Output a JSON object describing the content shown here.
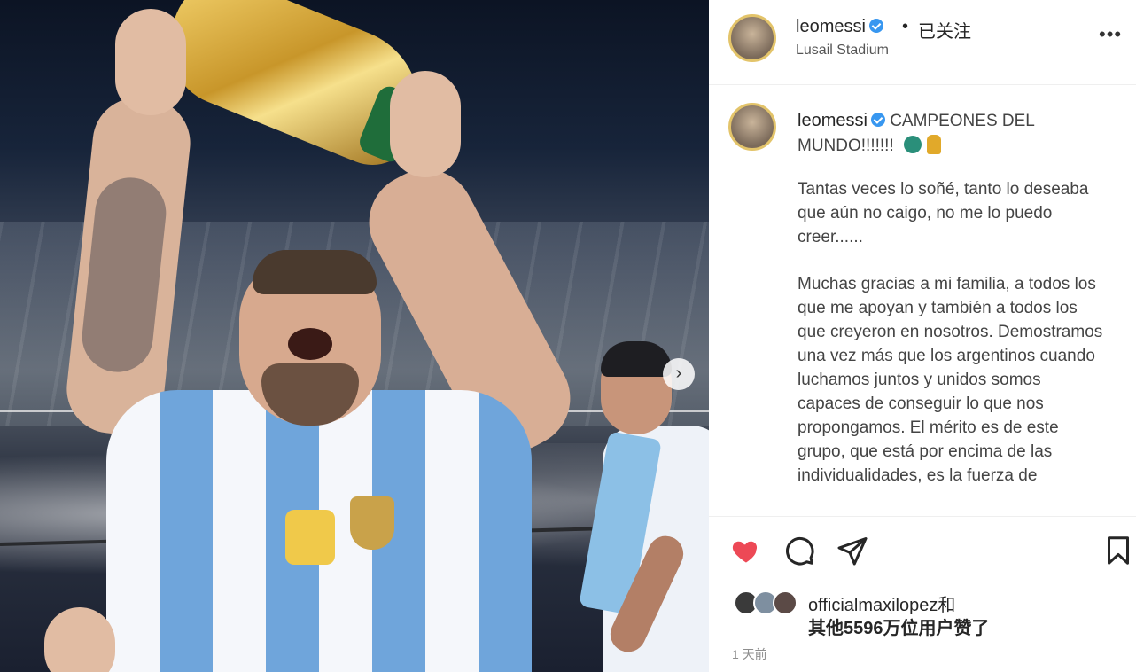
{
  "post": {
    "username": "leomessi",
    "separator": "•",
    "follow_status": "已关注",
    "location": "Lusail Stadium",
    "more": "•••",
    "caption_username": "leomessi",
    "caption_title": "CAMPEONES DEL MUNDO!!!!!!!",
    "paragraph_1": "Tantas veces lo soñé, tanto lo deseaba que aún no caigo, no me lo puedo creer......",
    "paragraph_2": "Muchas gracias a mi familia, a todos los que me apoyan y también a todos los que creyeron en nosotros. Demostramos una vez más que los argentinos cuando luchamos juntos y unidos somos capaces de conseguir lo que nos propongamos. El mérito es de este grupo, que está por encima de las individualidades, es la fuerza de",
    "likes_line_1": "officialmaxilopez和",
    "likes_line_2": "其他5596万位用户赞了",
    "time": "1 天前",
    "liked": true
  },
  "photo": {
    "next_icon": "›"
  },
  "colors": {
    "like_red": "#ed4956",
    "verified_blue": "#3897f0",
    "text": "#262626",
    "muted": "#8e8e8e"
  },
  "icons": {
    "like": "heart-icon",
    "comment": "comment-icon",
    "share": "paper-plane-icon",
    "save": "bookmark-icon",
    "next": "chevron-right-icon",
    "verified": "verified-badge-icon"
  }
}
